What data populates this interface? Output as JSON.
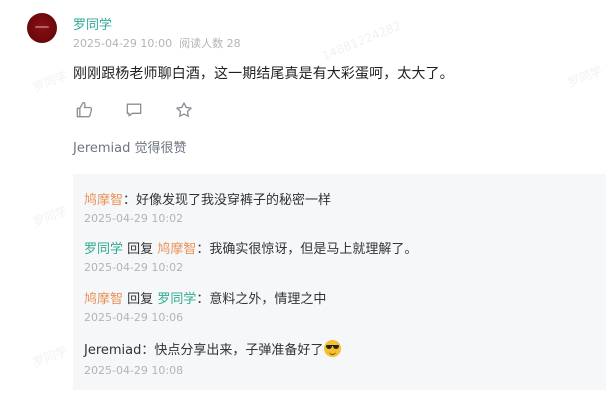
{
  "post": {
    "author": "罗同学",
    "date": "2025-04-29 10:00",
    "read_count_label": "阅读人数 28",
    "content": "刚刚跟杨老师聊白酒，这一期结尾真是有大彩蛋呵，太大了。",
    "likes_text": "Jeremiad 觉得很赞"
  },
  "actions": [
    {
      "icon": "thumbs-up-icon"
    },
    {
      "icon": "comment-icon"
    },
    {
      "icon": "star-icon"
    }
  ],
  "replies": [
    {
      "author": "鸠摩智",
      "reply_word": "",
      "target": "",
      "sep": "：",
      "text": "好像发现了我没穿裤子的秘密一样",
      "time": "2025-04-29 10:02"
    },
    {
      "author": "罗同学",
      "reply_word": "回复",
      "target": "鸠摩智",
      "sep": "：",
      "text": "我确实很惊讶，但是马上就理解了。",
      "time": "2025-04-29 10:02"
    },
    {
      "author": "鸠摩智",
      "reply_word": "回复",
      "target": "罗同学",
      "sep": "：",
      "text": "意料之外，情理之中",
      "time": "2025-04-29 10:06"
    },
    {
      "author": "Jeremiad",
      "reply_word": "",
      "target": "",
      "sep": "：",
      "text": "快点分享出来，子弹准备好了",
      "time": "2025-04-29 10:08"
    }
  ],
  "colors": {
    "username_green": "#2eaa91",
    "username_orange": "#e8935a",
    "reply_bg": "#f6f7f9",
    "meta_gray": "#b4b4b4"
  }
}
